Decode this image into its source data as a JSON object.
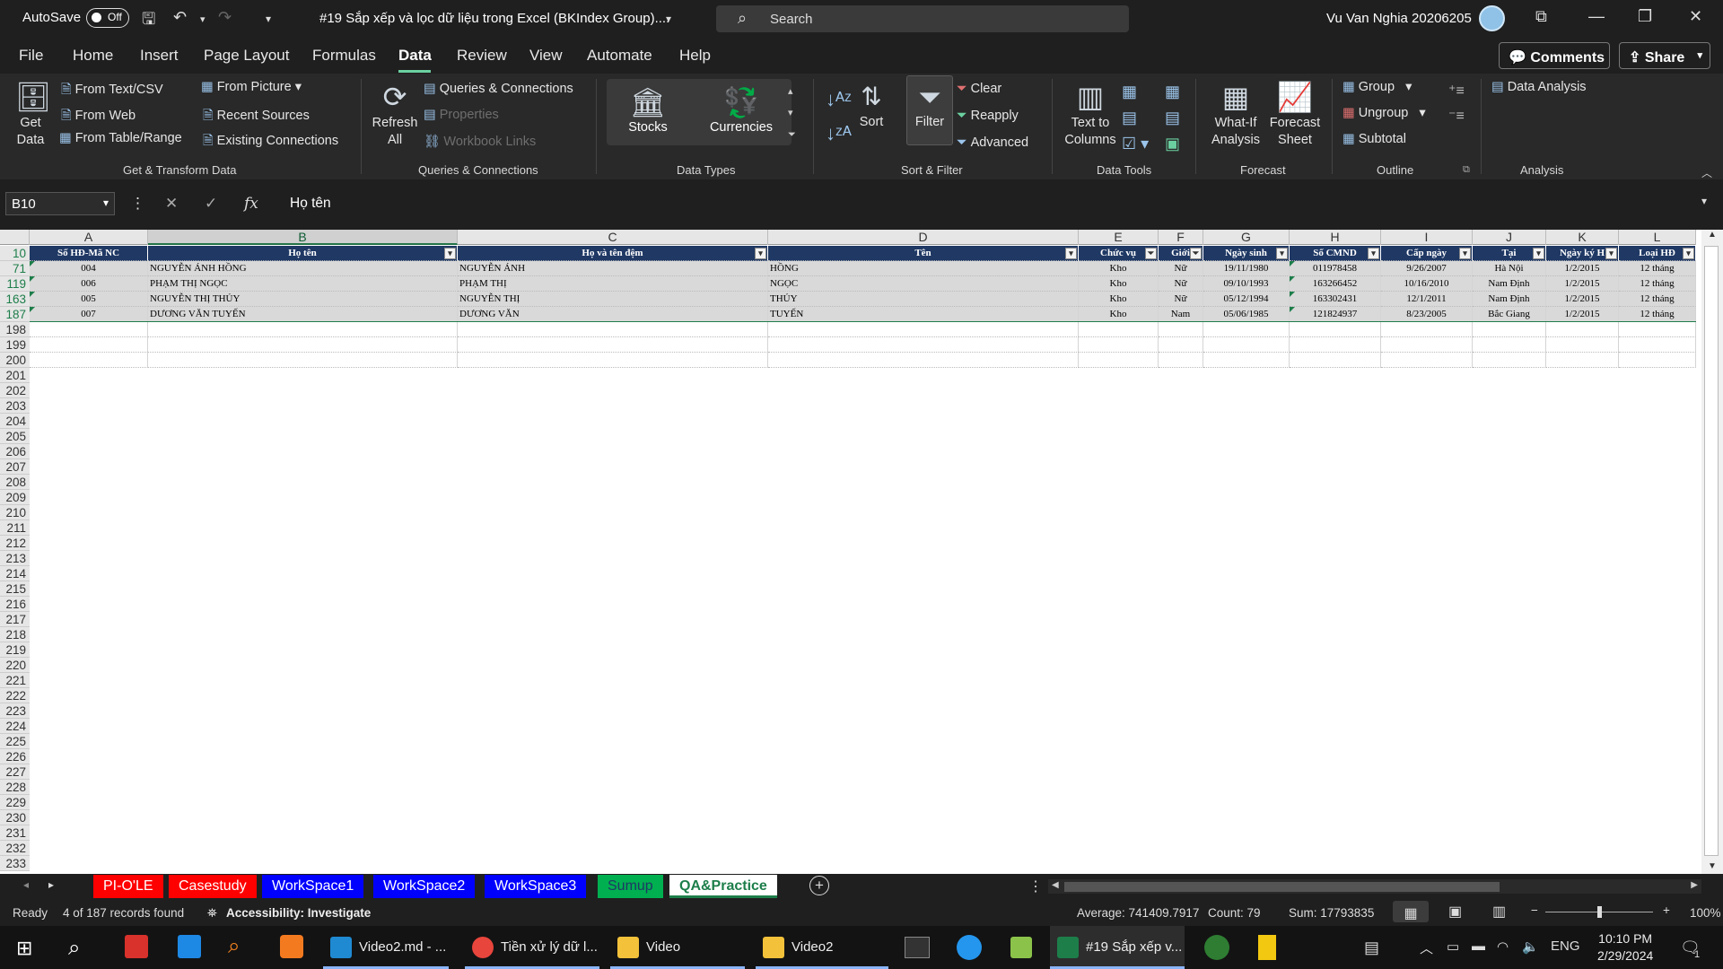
{
  "title_bar": {
    "autosave_label": "AutoSave",
    "autosave_state": "Off",
    "doc_title": "#19 Sắp xếp và lọc dữ liệu trong Excel (BKIndex Group)....",
    "search_placeholder": "Search",
    "user_name": "Vu Van Nghia 20206205"
  },
  "menu": [
    "File",
    "Home",
    "Insert",
    "Page Layout",
    "Formulas",
    "Data",
    "Review",
    "View",
    "Automate",
    "Help"
  ],
  "menu_active": "Data",
  "comments_label": "Comments",
  "share_label": "Share",
  "ribbon": {
    "get_data": "Get Data",
    "from_text_csv": "From Text/CSV",
    "from_web": "From Web",
    "from_table_range": "From Table/Range",
    "from_picture": "From Picture",
    "recent_sources": "Recent Sources",
    "existing_connections": "Existing Connections",
    "get_transform_label": "Get & Transform Data",
    "refresh_all": "Refresh All",
    "queries_connections": "Queries & Connections",
    "properties": "Properties",
    "workbook_links": "Workbook Links",
    "queries_group_label": "Queries & Connections",
    "stocks": "Stocks",
    "currencies": "Currencies",
    "data_types_label": "Data Types",
    "sort": "Sort",
    "filter": "Filter",
    "clear": "Clear",
    "reapply": "Reapply",
    "advanced": "Advanced",
    "sort_filter_label": "Sort & Filter",
    "text_to_columns": "Text to Columns",
    "data_tools_label": "Data Tools",
    "what_if": "What-If Analysis",
    "forecast_sheet": "Forecast Sheet",
    "forecast_label": "Forecast",
    "group": "Group",
    "ungroup": "Ungroup",
    "subtotal": "Subtotal",
    "outline_label": "Outline",
    "data_analysis": "Data Analysis",
    "analysis_label": "Analysis"
  },
  "formula_bar": {
    "name_box": "B10",
    "formula": "Họ tên"
  },
  "grid": {
    "columns": [
      "A",
      "B",
      "C",
      "D",
      "E",
      "F",
      "G",
      "H",
      "I",
      "J",
      "K",
      "L"
    ],
    "header_row_number": "10",
    "table_headers": [
      "Số HĐ-Mã NC",
      "Họ tên",
      "Họ và tên đệm",
      "Tên",
      "Chức vụ",
      "Giới",
      "Ngày sinh",
      "Số CMND",
      "Cấp ngày",
      "Tại",
      "Ngày ký H",
      "Loại HĐ"
    ],
    "rows": [
      {
        "row_num": "71",
        "cells": [
          "004",
          "NGUYỄN ÁNH HỒNG",
          "NGUYỄN ÁNH",
          "HỒNG",
          "Kho",
          "Nữ",
          "19/11/1980",
          "011978458",
          "9/26/2007",
          "Hà Nội",
          "1/2/2015",
          "12 tháng"
        ]
      },
      {
        "row_num": "119",
        "cells": [
          "006",
          "PHẠM THỊ NGỌC",
          "PHẠM THỊ",
          "NGỌC",
          "Kho",
          "Nữ",
          "09/10/1993",
          "163266452",
          "10/16/2010",
          "Nam Định",
          "1/2/2015",
          "12 tháng"
        ]
      },
      {
        "row_num": "163",
        "cells": [
          "005",
          "NGUYỄN THỊ THỦY",
          "NGUYỄN THỊ",
          "THỦY",
          "Kho",
          "Nữ",
          "05/12/1994",
          "163302431",
          "12/1/2011",
          "Nam Định",
          "1/2/2015",
          "12 tháng"
        ]
      },
      {
        "row_num": "187",
        "cells": [
          "007",
          "DƯƠNG VĂN TUYẾN",
          "DƯƠNG VĂN",
          "TUYẾN",
          "Kho",
          "Nam",
          "05/06/1985",
          "121824937",
          "8/23/2005",
          "Bắc Giang",
          "1/2/2015",
          "12 tháng"
        ]
      }
    ],
    "empty_row_numbers": [
      "198",
      "199",
      "200",
      "201",
      "202",
      "203",
      "204",
      "205",
      "206",
      "207",
      "208",
      "209",
      "210",
      "211",
      "212",
      "213",
      "214",
      "215",
      "216",
      "217",
      "218",
      "219",
      "220",
      "221",
      "222",
      "223",
      "224",
      "225",
      "226",
      "227",
      "228",
      "229",
      "230",
      "231",
      "232",
      "233"
    ]
  },
  "sheets": [
    {
      "name": "PI-O'LE",
      "color": "#ff0000",
      "text": "#ffffff"
    },
    {
      "name": "Casestudy",
      "color": "#ff0000",
      "text": "#ffffff"
    },
    {
      "name": "WorkSpace1",
      "color": "#0000ff",
      "text": "#ffffff"
    },
    {
      "name": "WorkSpace2",
      "color": "#0000ff",
      "text": "#ffffff"
    },
    {
      "name": "WorkSpace3",
      "color": "#0000ff",
      "text": "#ffffff"
    },
    {
      "name": "Sumup",
      "color": "#00b050",
      "text": "#1f3864"
    },
    {
      "name": "QA&Practice",
      "color": "#ffffff",
      "text": "#1d7e4a"
    }
  ],
  "status_bar": {
    "mode": "Ready",
    "records": "4 of 187 records found",
    "accessibility": "Accessibility: Investigate",
    "average": "Average: 741409.7917",
    "count": "Count: 79",
    "sum": "Sum: 17793835",
    "zoom": "100%"
  },
  "taskbar": {
    "apps": [
      "Video2.md - ...",
      "Tiền xử lý dữ l...",
      "Video",
      "Video2",
      "#19 Sắp xếp v..."
    ],
    "lang": "ENG",
    "time": "10:10 PM",
    "date": "2/29/2024",
    "notif_count": "1"
  },
  "colors": {
    "accent": "#217346",
    "table_header": "#1f3864",
    "filtered_row": "#d9d9d9"
  }
}
